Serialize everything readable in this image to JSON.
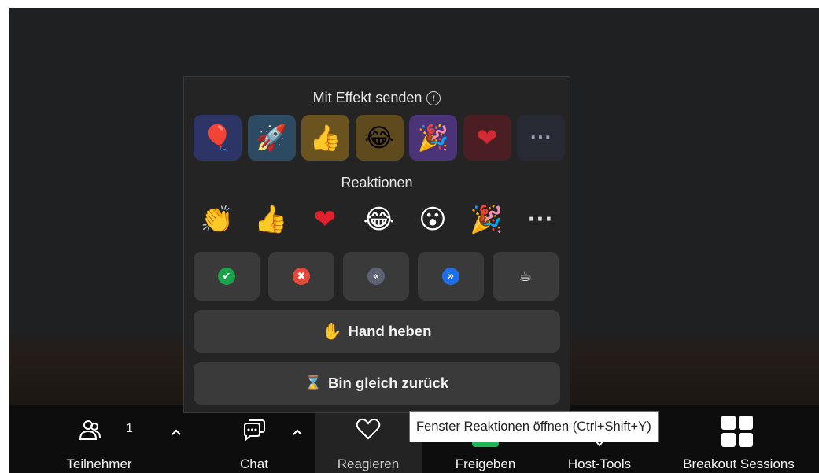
{
  "popup": {
    "effects_title": "Mit Effekt senden",
    "effects": [
      {
        "icon": "balloon-icon",
        "glyph": "🎈",
        "bg": "#2c3566"
      },
      {
        "icon": "rocket-icon",
        "glyph": "🚀",
        "bg": "#2d4a63"
      },
      {
        "icon": "thumbs-up-icon",
        "glyph": "👍",
        "bg": "#6b5320"
      },
      {
        "icon": "tears-of-joy-icon",
        "glyph": "😂",
        "bg": "#5f4a1e"
      },
      {
        "icon": "party-popper-icon",
        "glyph": "🎉",
        "bg": "#4a3376"
      },
      {
        "icon": "heart-icon",
        "glyph": "❤",
        "bg": "#4a1e22"
      },
      {
        "icon": "more-icon",
        "glyph": "···",
        "bg": "#272a33"
      }
    ],
    "reactions_title": "Reaktionen",
    "reactions": [
      {
        "icon": "clapping-hands-icon",
        "glyph": "👏"
      },
      {
        "icon": "thumbs-up-icon",
        "glyph": "👍"
      },
      {
        "icon": "heart-icon",
        "glyph": "❤"
      },
      {
        "icon": "tears-of-joy-icon",
        "glyph": "😂"
      },
      {
        "icon": "surprised-face-icon",
        "glyph": "😮"
      },
      {
        "icon": "party-popper-icon",
        "glyph": "🎉"
      },
      {
        "icon": "more-icon",
        "glyph": "···"
      }
    ],
    "statuses": [
      {
        "icon": "yes-check-icon",
        "glyph": "✔",
        "color": "#1aa34a"
      },
      {
        "icon": "no-cross-icon",
        "glyph": "✖",
        "color": "#e5493a"
      },
      {
        "icon": "slower-icon",
        "glyph": "«",
        "color": "#5d6275"
      },
      {
        "icon": "faster-icon",
        "glyph": "»",
        "color": "#1e6fe8"
      },
      {
        "icon": "coffee-icon",
        "glyph": "☕",
        "color": "#3a3a3a"
      }
    ],
    "raise_hand_glyph": "✋",
    "raise_hand_label": "Hand heben",
    "away_glyph": "⌛",
    "away_label": "Bin gleich zurück"
  },
  "tooltip": "Fenster Reaktionen öffnen (Ctrl+Shift+Y)",
  "toolbar": {
    "participants_label": "Teilnehmer",
    "participants_count": "1",
    "chat_label": "Chat",
    "react_label": "Reagieren",
    "share_label": "Freigeben",
    "host_tools_label": "Host-Tools",
    "breakout_label": "Breakout Sessions"
  }
}
